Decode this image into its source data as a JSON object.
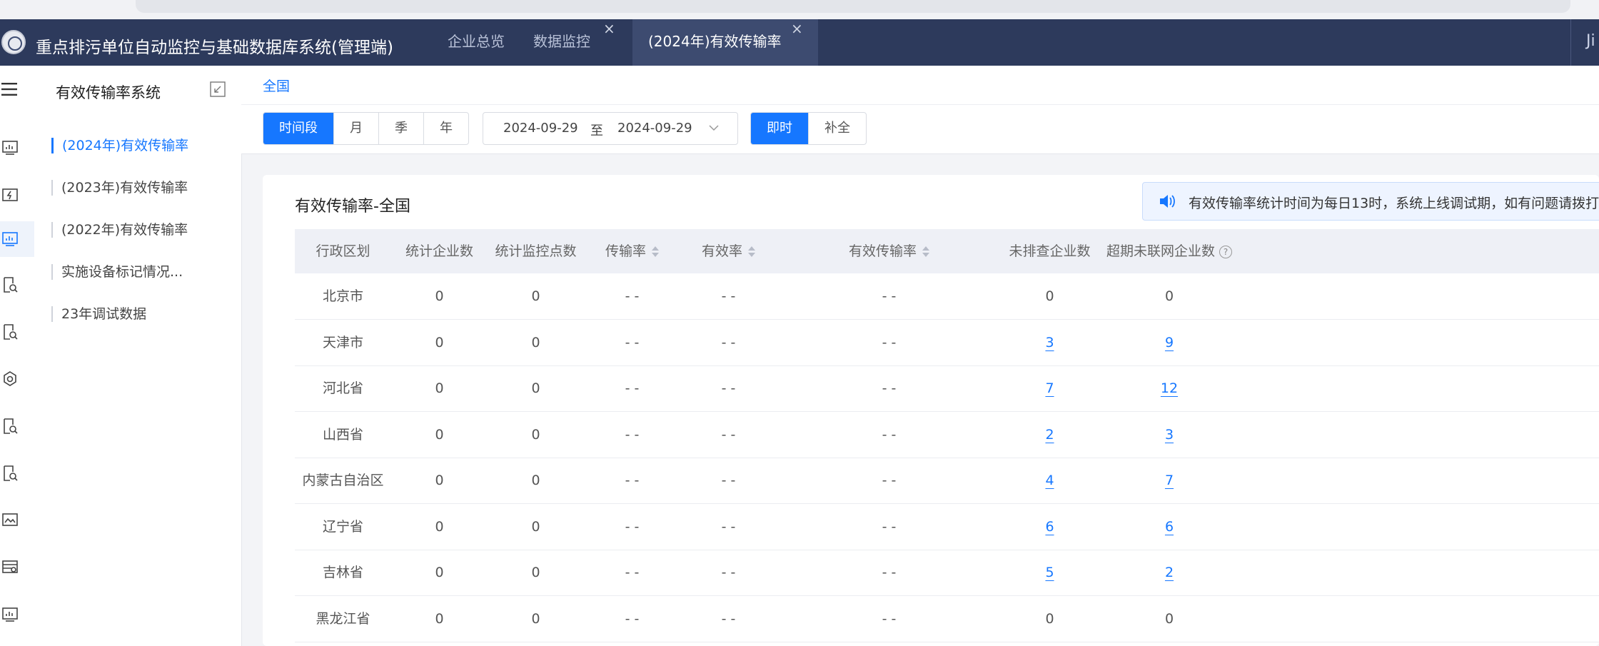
{
  "header": {
    "app_title": "重点排污单位自动监控与基础数据库系统(管理端)",
    "tabs": [
      {
        "label": "企业总览",
        "closable": false,
        "active": false
      },
      {
        "label": "数据监控",
        "closable": true,
        "active": false
      },
      {
        "label": "(2024年)有效传输率",
        "closable": true,
        "active": true
      }
    ],
    "close_glyph": "×",
    "user_label": "Ji"
  },
  "sidebar": {
    "title": "有效传输率系统",
    "items": [
      {
        "label": "(2024年)有效传输率",
        "active": true
      },
      {
        "label": "(2023年)有效传输率",
        "active": false
      },
      {
        "label": "(2022年)有效传输率",
        "active": false
      },
      {
        "label": "实施设备标记情况...",
        "active": false
      },
      {
        "label": "23年调试数据",
        "active": false
      }
    ]
  },
  "breadcrumb": "全国",
  "filters": {
    "period_options": [
      "时间段",
      "月",
      "季",
      "年"
    ],
    "period_selected": "时间段",
    "date_start": "2024-09-29",
    "date_sep": "至",
    "date_end": "2024-09-29",
    "mode_options": [
      "即时",
      "补全"
    ],
    "mode_selected": "即时"
  },
  "card": {
    "title": "有效传输率-全国",
    "notice": "有效传输率统计时间为每日13时，系统上线调试期，如有问题请拨打"
  },
  "table": {
    "columns": [
      "行政区划",
      "统计企业数",
      "统计监控点数",
      "传输率",
      "有效率",
      "有效传输率",
      "未排查企业数",
      "超期未联网企业数"
    ],
    "rows": [
      {
        "region": "北京市",
        "companies": "0",
        "points": "0",
        "transfer_rate": "- -",
        "valid_rate": "- -",
        "valid_transfer_rate": "- -",
        "unchecked": "0",
        "overdue": "0"
      },
      {
        "region": "天津市",
        "companies": "0",
        "points": "0",
        "transfer_rate": "- -",
        "valid_rate": "- -",
        "valid_transfer_rate": "- -",
        "unchecked": "3",
        "overdue": "9"
      },
      {
        "region": "河北省",
        "companies": "0",
        "points": "0",
        "transfer_rate": "- -",
        "valid_rate": "- -",
        "valid_transfer_rate": "- -",
        "unchecked": "7",
        "overdue": "12"
      },
      {
        "region": "山西省",
        "companies": "0",
        "points": "0",
        "transfer_rate": "- -",
        "valid_rate": "- -",
        "valid_transfer_rate": "- -",
        "unchecked": "2",
        "overdue": "3"
      },
      {
        "region": "内蒙古自治区",
        "companies": "0",
        "points": "0",
        "transfer_rate": "- -",
        "valid_rate": "- -",
        "valid_transfer_rate": "- -",
        "unchecked": "4",
        "overdue": "7"
      },
      {
        "region": "辽宁省",
        "companies": "0",
        "points": "0",
        "transfer_rate": "- -",
        "valid_rate": "- -",
        "valid_transfer_rate": "- -",
        "unchecked": "6",
        "overdue": "6"
      },
      {
        "region": "吉林省",
        "companies": "0",
        "points": "0",
        "transfer_rate": "- -",
        "valid_rate": "- -",
        "valid_transfer_rate": "- -",
        "unchecked": "5",
        "overdue": "2"
      },
      {
        "region": "黑龙江省",
        "companies": "0",
        "points": "0",
        "transfer_rate": "- -",
        "valid_rate": "- -",
        "valid_transfer_rate": "- -",
        "unchecked": "0",
        "overdue": "0"
      }
    ]
  },
  "colors": {
    "header_bg": "#2d3a5c",
    "accent": "#1677ff",
    "table_header_bg": "#eef0f6"
  },
  "icons": {
    "rail": [
      "menu-icon",
      "chart-icon",
      "lightning-doc-icon",
      "bar-chart-icon",
      "doc-search-icon",
      "doc-search-icon",
      "gear-search-icon",
      "doc-search-icon",
      "doc-search-icon",
      "image-doc-icon",
      "table-gear-icon",
      "monitor-chart-icon"
    ]
  }
}
